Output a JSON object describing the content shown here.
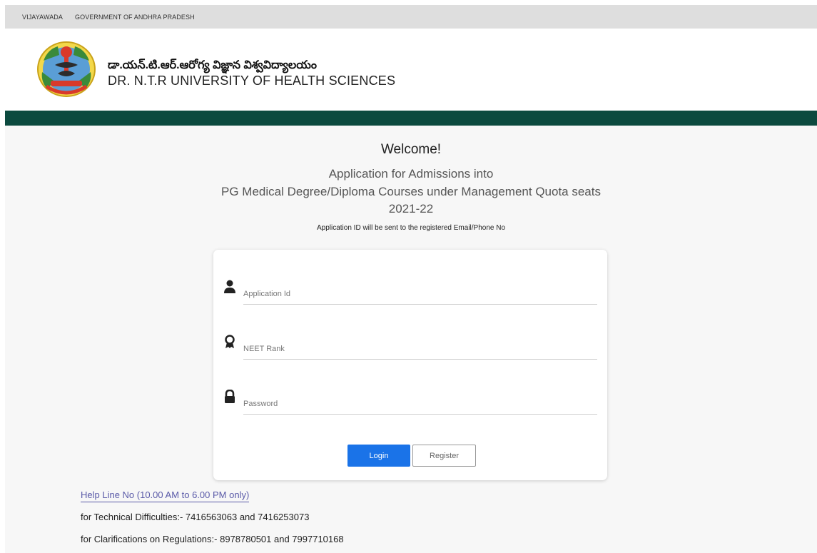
{
  "topbar": {
    "links": [
      "VIJAYAWADA",
      "GOVERNMENT OF ANDHRA PRADESH"
    ]
  },
  "header": {
    "university_telugu": "డా.యన్.టి.ఆర్.ఆరోగ్య విజ్ఞాన విశ్వవిద్యాలయం",
    "university_english": "DR. N.T.R UNIVERSITY OF HEALTH SCIENCES"
  },
  "main": {
    "welcome": "Welcome!",
    "subtitle_line1": "Application for Admissions into",
    "subtitle_line2": "PG Medical Degree/Diploma Courses under Management Quota seats",
    "subtitle_line3": "2021-22",
    "note": "Application ID will be sent to the registered Email/Phone No"
  },
  "form": {
    "application_id": {
      "placeholder": "Application Id",
      "icon": "user-icon"
    },
    "neet_rank": {
      "placeholder": "NEET Rank",
      "icon": "award-icon"
    },
    "password": {
      "placeholder": "Password",
      "icon": "lock-icon"
    },
    "login_label": "Login",
    "register_label": "Register"
  },
  "footer": {
    "helpline": "Help Line No (10.00 AM to 6.00 PM only)",
    "technical": "for Technical Difficulties:- 7416563063 and 7416253073",
    "clarifications": "for Clarifications on Regulations:- 8978780501 and 7997710168"
  },
  "colors": {
    "accent": "#1a73e8",
    "header_band": "#0c4a3f",
    "link": "#5a5aa8"
  }
}
